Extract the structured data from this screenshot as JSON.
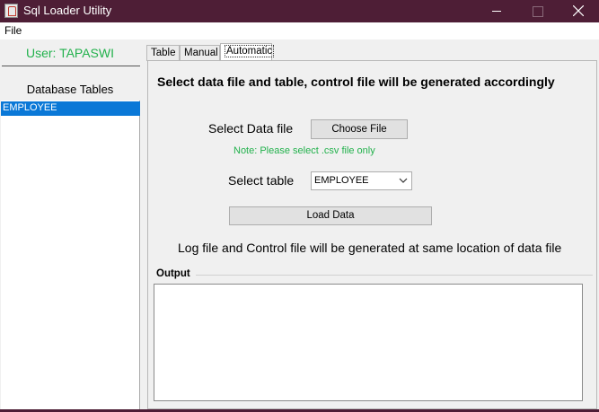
{
  "window": {
    "title": "Sql Loader Utility"
  },
  "menubar": {
    "file": "File"
  },
  "sidebar": {
    "user_label": "User: TAPASWI",
    "tables_heading": "Database Tables",
    "tables": [
      "EMPLOYEE"
    ]
  },
  "tabs": [
    {
      "label": "Table",
      "active": false
    },
    {
      "label": "Manual",
      "active": false
    },
    {
      "label": "Automatic",
      "active": true
    }
  ],
  "automatic": {
    "heading": "Select data file and table, control file will be generated accordingly",
    "data_file_label": "Select Data file",
    "choose_file_button": "Choose File",
    "note": "Note: Please select .csv file only",
    "table_label": "Select table",
    "table_selected": "EMPLOYEE",
    "load_button": "Load Data",
    "info": "Log file and Control file will be generated at same location of data file",
    "output_label": "Output",
    "output_text": ""
  },
  "colors": {
    "titlebar": "#4e1e36",
    "accent_green": "#22b14c",
    "selection": "#0a78d7"
  }
}
